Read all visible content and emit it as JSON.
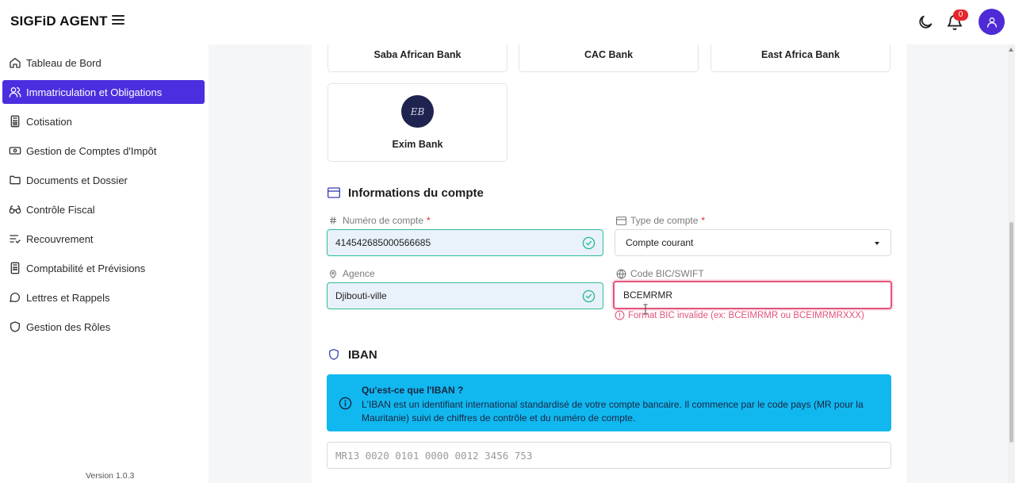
{
  "app": {
    "brand": "SIGFiD AGENT"
  },
  "header": {
    "notification_count": "0",
    "icons": [
      "menu-icon",
      "moon-icon",
      "bell-icon",
      "user-icon"
    ]
  },
  "sidebar": {
    "items": [
      {
        "label": "Tableau de Bord",
        "icon": "home-icon"
      },
      {
        "label": "Immatriculation et Obligations",
        "icon": "users-icon",
        "active": true
      },
      {
        "label": "Cotisation",
        "icon": "calculator-icon"
      },
      {
        "label": "Gestion de Comptes d'Impôt",
        "icon": "banknote-icon"
      },
      {
        "label": "Documents et Dossier",
        "icon": "folder-icon"
      },
      {
        "label": "Contrôle Fiscal",
        "icon": "glasses-icon"
      },
      {
        "label": "Recouvrement",
        "icon": "list-check-icon"
      },
      {
        "label": "Comptabilité et Prévisions",
        "icon": "calculator-icon"
      },
      {
        "label": "Lettres et Rappels",
        "icon": "message-icon"
      },
      {
        "label": "Gestion des Rôles",
        "icon": "shield-icon"
      }
    ],
    "version": "Version 1.0.3"
  },
  "banks": {
    "cards": [
      "Saba African Bank",
      "CAC Bank",
      "East Africa Bank",
      "Exim Bank"
    ]
  },
  "account_section": {
    "title": "Informations du compte",
    "account_number": {
      "label": "Numéro de compte",
      "required": "*",
      "value": "414542685000566685"
    },
    "account_type": {
      "label": "Type de compte",
      "required": "*",
      "value": "Compte courant"
    },
    "agency": {
      "label": "Agence",
      "value": "Djibouti-ville"
    },
    "bic": {
      "label": "Code BIC/SWIFT",
      "value": "BCEMRMR",
      "error": "Format BIC invalide (ex: BCEIMRMR ou BCEIMRMRXXX)"
    }
  },
  "iban_section": {
    "title": "IBAN",
    "info_title": "Qu'est-ce que l'IBAN ?",
    "info_text": "L'IBAN est un identifiant international standardisé de votre compte bancaire. Il commence par le code pays (MR pour la Mauritanie) suivi de chiffres de contrôle et du numéro de compte.",
    "placeholder": "MR13 0020 0101 0000 0012 3456 753"
  },
  "colors": {
    "accent": "#4b2ee0",
    "info": "#11b8f0",
    "valid": "#2fbd94",
    "error": "#e1547a"
  }
}
